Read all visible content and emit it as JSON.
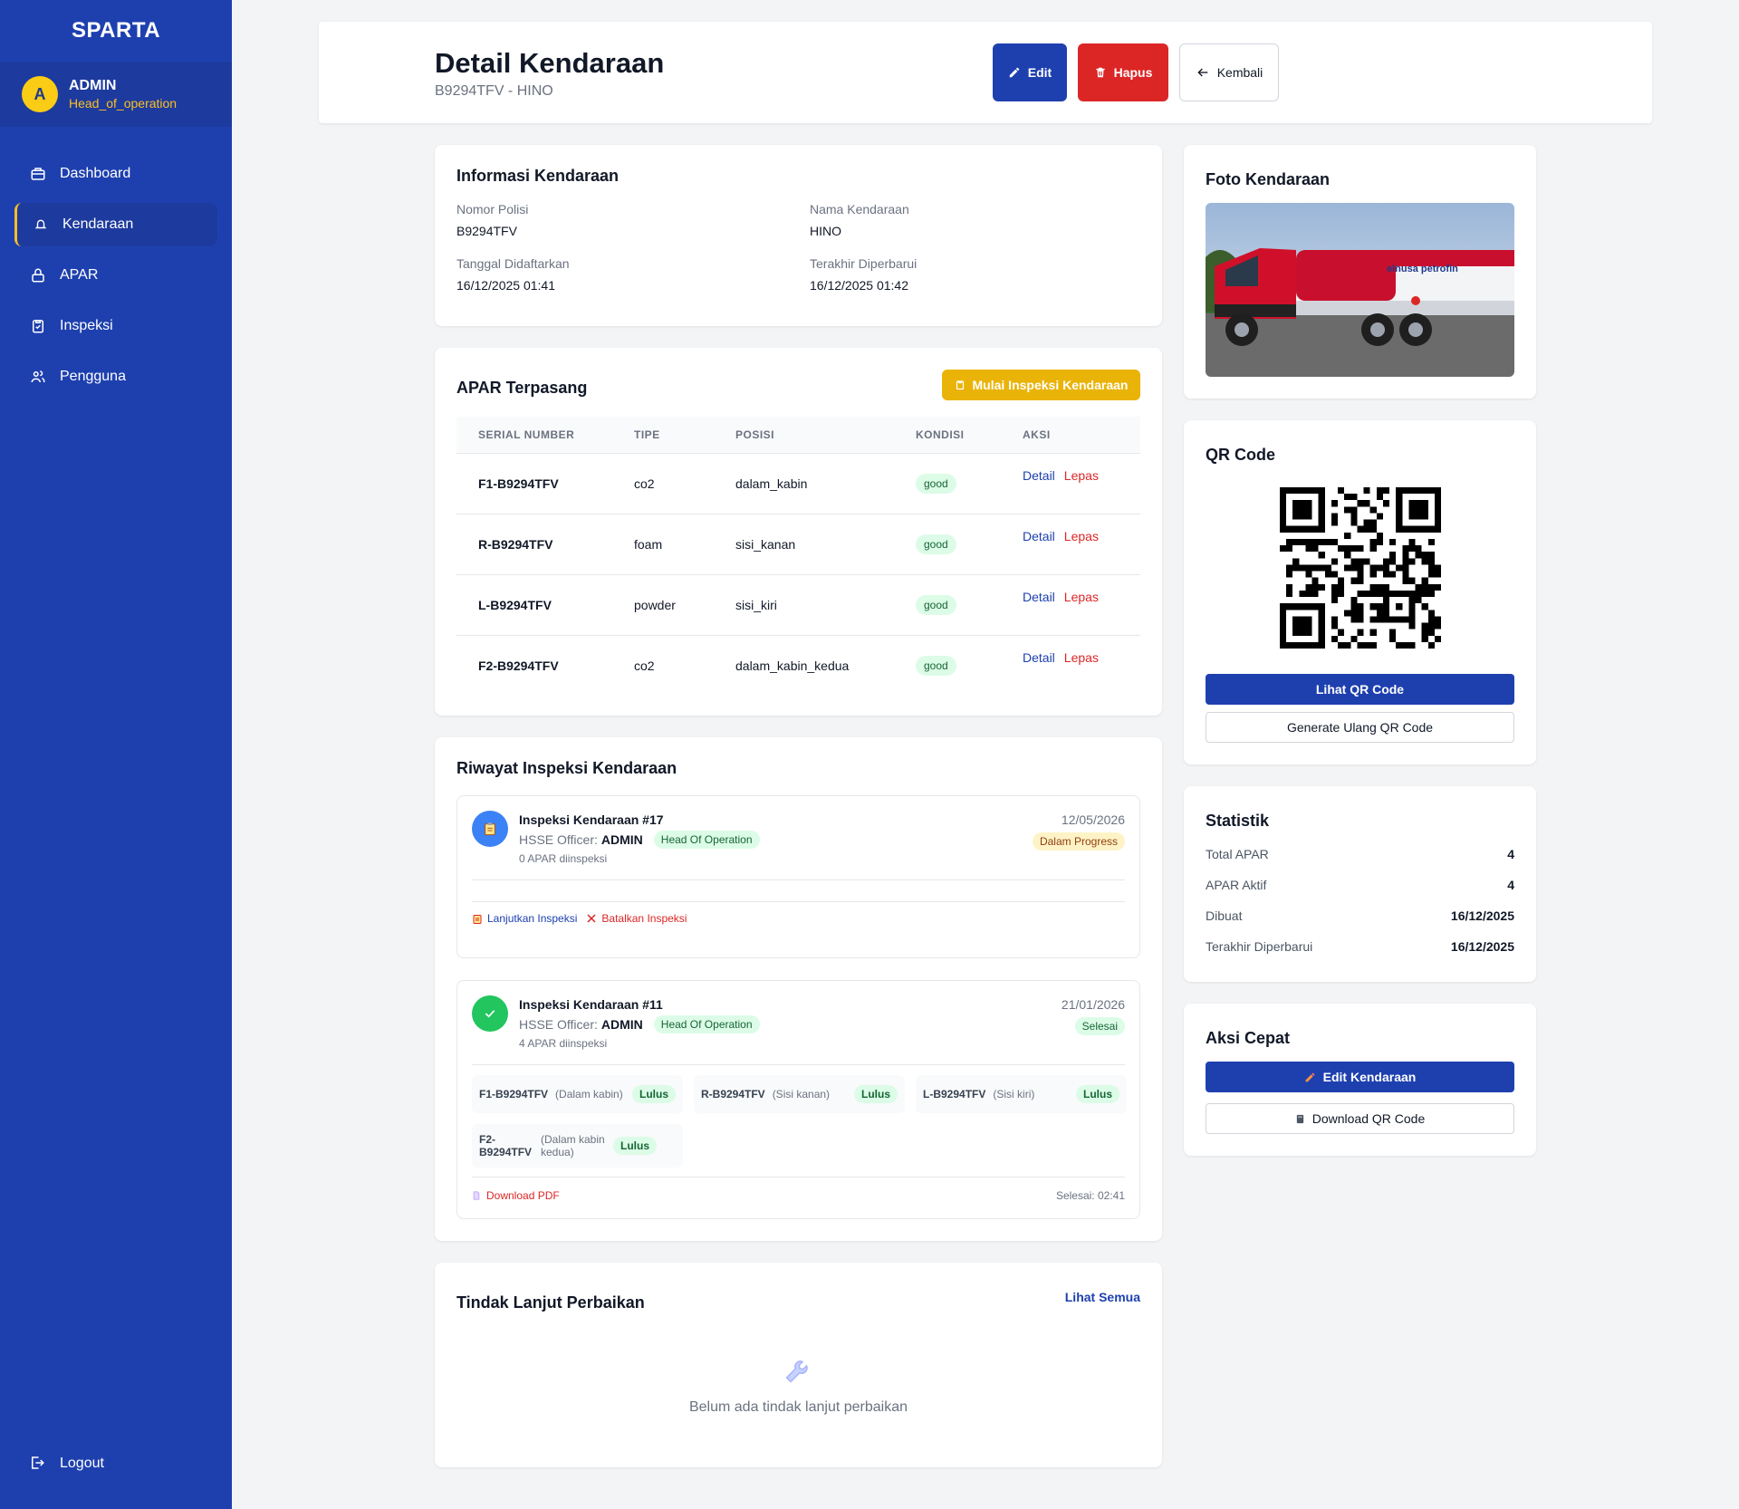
{
  "app": {
    "brand": "SPARTA"
  },
  "user": {
    "initial": "A",
    "name": "ADMIN",
    "role": "Head_of_operation"
  },
  "nav": {
    "dashboard": "Dashboard",
    "kendaraan": "Kendaraan",
    "apar": "APAR",
    "inspeksi": "Inspeksi",
    "pengguna": "Pengguna",
    "logout": "Logout"
  },
  "header": {
    "title": "Detail Kendaraan",
    "subtitle": "B9294TFV - HINO",
    "edit": "Edit",
    "hapus": "Hapus",
    "kembali": "Kembali"
  },
  "info": {
    "title": "Informasi Kendaraan",
    "nopol_label": "Nomor Polisi",
    "nopol": "B9294TFV",
    "nama_label": "Nama Kendaraan",
    "nama": "HINO",
    "daftar_label": "Tanggal Didaftarkan",
    "daftar": "16/12/2025 01:41",
    "update_label": "Terakhir Diperbarui",
    "update": "16/12/2025 01:42"
  },
  "apar": {
    "title": "APAR Terpasang",
    "start_button": "Mulai Inspeksi Kendaraan",
    "columns": [
      "SERIAL NUMBER",
      "TIPE",
      "POSISI",
      "KONDISI",
      "AKSI"
    ],
    "detail_label": "Detail",
    "lepas_label": "Lepas",
    "rows": [
      {
        "serial": "F1-B9294TFV",
        "tipe": "co2",
        "posisi": "dalam_kabin",
        "kondisi": "good"
      },
      {
        "serial": "R-B9294TFV",
        "tipe": "foam",
        "posisi": "sisi_kanan",
        "kondisi": "good"
      },
      {
        "serial": "L-B9294TFV",
        "tipe": "powder",
        "posisi": "sisi_kiri",
        "kondisi": "good"
      },
      {
        "serial": "F2-B9294TFV",
        "tipe": "co2",
        "posisi": "dalam_kabin_kedua",
        "kondisi": "good"
      }
    ]
  },
  "riwayat": {
    "title": "Riwayat Inspeksi Kendaraan",
    "items": [
      {
        "title": "Inspeksi Kendaraan #17",
        "officer_label": "HSSE Officer:",
        "officer": "ADMIN",
        "role": "Head Of Operation",
        "count": "0 APAR diinspeksi",
        "date": "12/05/2026",
        "status": "Dalam Progress",
        "lanjut": "Lanjutkan Inspeksi",
        "batal": "Batalkan Inspeksi"
      },
      {
        "title": "Inspeksi Kendaraan #11",
        "officer_label": "HSSE Officer:",
        "officer": "ADMIN",
        "role": "Head Of Operation",
        "count": "4 APAR diinspeksi",
        "date": "21/01/2026",
        "status": "Selesai",
        "results": [
          {
            "serial": "F1-B9294TFV",
            "pos": "(Dalam kabin)",
            "result": "Lulus"
          },
          {
            "serial": "R-B9294TFV",
            "pos": "(Sisi kanan)",
            "result": "Lulus"
          },
          {
            "serial": "L-B9294TFV",
            "pos": "(Sisi kiri)",
            "result": "Lulus"
          },
          {
            "serial": "F2-B9294TFV",
            "pos": "(Dalam kabin kedua)",
            "result": "Lulus"
          }
        ],
        "download": "Download PDF",
        "done": "Selesai: 02:41"
      }
    ]
  },
  "tindak": {
    "title": "Tindak Lanjut Perbaikan",
    "lihat_semua": "Lihat Semua",
    "empty": "Belum ada tindak lanjut perbaikan"
  },
  "foto": {
    "title": "Foto Kendaraan",
    "truck_brand": "elnusa petrofin"
  },
  "qr": {
    "title": "QR Code",
    "lihat": "Lihat QR Code",
    "generate": "Generate Ulang QR Code"
  },
  "statistik": {
    "title": "Statistik",
    "total_label": "Total APAR",
    "total": "4",
    "aktif_label": "APAR Aktif",
    "aktif": "4",
    "dibuat_label": "Dibuat",
    "dibuat": "16/12/2025",
    "update_label": "Terakhir Diperbarui",
    "update": "16/12/2025"
  },
  "aksi_cepat": {
    "title": "Aksi Cepat",
    "edit": "Edit Kendaraan",
    "download": "Download QR Code"
  },
  "colors": {
    "primary": "#1e40af",
    "danger": "#dc2626",
    "warning": "#eab308",
    "success": "#16a34a"
  }
}
